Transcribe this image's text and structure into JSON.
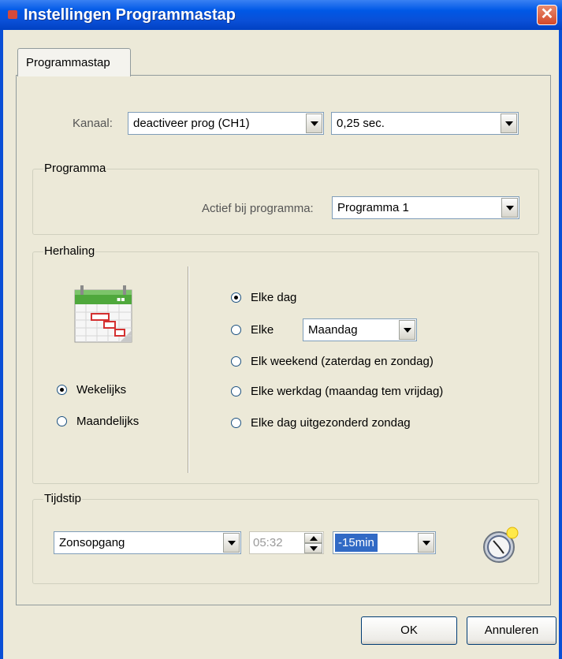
{
  "window": {
    "title": "Instellingen Programmastap",
    "close_label": "✕"
  },
  "tabs": [
    {
      "label": "Programmastap"
    }
  ],
  "channel": {
    "label": "Kanaal:",
    "value": "deactiveer prog (CH1)",
    "duration": "0,25 sec."
  },
  "programma": {
    "group_title": "Programma",
    "label": "Actief bij programma:",
    "value": "Programma 1"
  },
  "herhaling": {
    "group_title": "Herhaling",
    "frequency": [
      {
        "label": "Wekelijks",
        "checked": true
      },
      {
        "label": "Maandelijks",
        "checked": false
      }
    ],
    "options": [
      {
        "label": "Elke dag",
        "checked": true
      },
      {
        "label": "Elke",
        "checked": false
      },
      {
        "label": "Elk weekend (zaterdag en zondag)",
        "checked": false
      },
      {
        "label": "Elke werkdag (maandag tem vrijdag)",
        "checked": false
      },
      {
        "label": "Elke dag uitgezonderd zondag",
        "checked": false
      }
    ],
    "weekday": "Maandag"
  },
  "tijdstip": {
    "group_title": "Tijdstip",
    "event": "Zonsopgang",
    "time": "05:32",
    "offset": "-15min"
  },
  "buttons": {
    "ok": "OK",
    "cancel": "Annuleren"
  },
  "colors": {
    "titlebar": "#0058e6",
    "close": "#d4492a",
    "dialog_bg": "#ece9d8",
    "selection": "#316ac5"
  }
}
